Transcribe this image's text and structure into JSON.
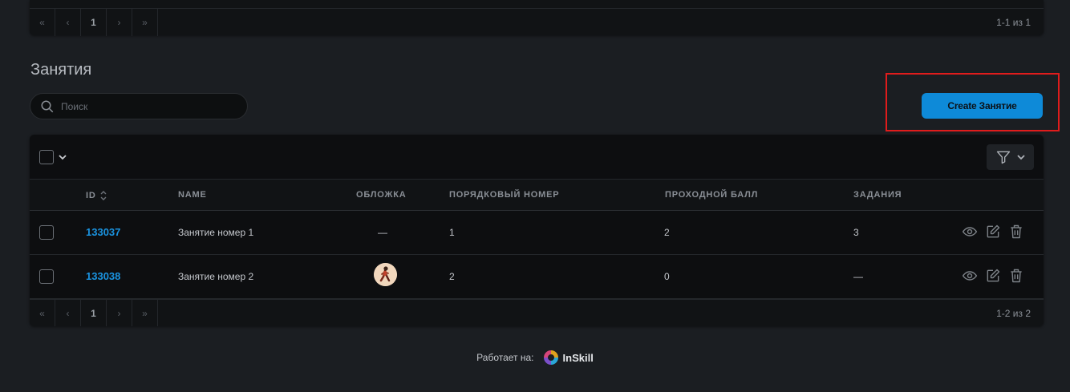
{
  "top_pager": {
    "first": "«",
    "prev": "‹",
    "current": "1",
    "next": "›",
    "last": "»",
    "count": "1-1 из 1"
  },
  "section": {
    "title": "Занятия"
  },
  "search": {
    "placeholder": "Поиск"
  },
  "create_button": {
    "label": "Create Занятие"
  },
  "table": {
    "headers": {
      "id": "ID",
      "name": "NAME",
      "cover": "ОБЛОЖКА",
      "order": "ПОРЯДКОВЫЙ НОМЕР",
      "passing_score": "ПРОХОДНОЙ БАЛЛ",
      "tasks": "ЗАДАНИЯ"
    },
    "rows": [
      {
        "id": "133037",
        "name": "Занятие номер 1",
        "cover": "—",
        "order": "1",
        "passing_score": "2",
        "tasks": "3"
      },
      {
        "id": "133038",
        "name": "Занятие номер 2",
        "cover": "",
        "order": "2",
        "passing_score": "0",
        "tasks": "—"
      }
    ]
  },
  "bottom_pager": {
    "first": "«",
    "prev": "‹",
    "current": "1",
    "next": "›",
    "last": "»",
    "count": "1-2 из 2"
  },
  "footer": {
    "powered_by": "Работает на:",
    "brand": "InSkill"
  },
  "colors": {
    "accent": "#0e8ad8",
    "link": "#1a93e0",
    "highlight": "#e01c1c",
    "background": "#1b1e22"
  }
}
